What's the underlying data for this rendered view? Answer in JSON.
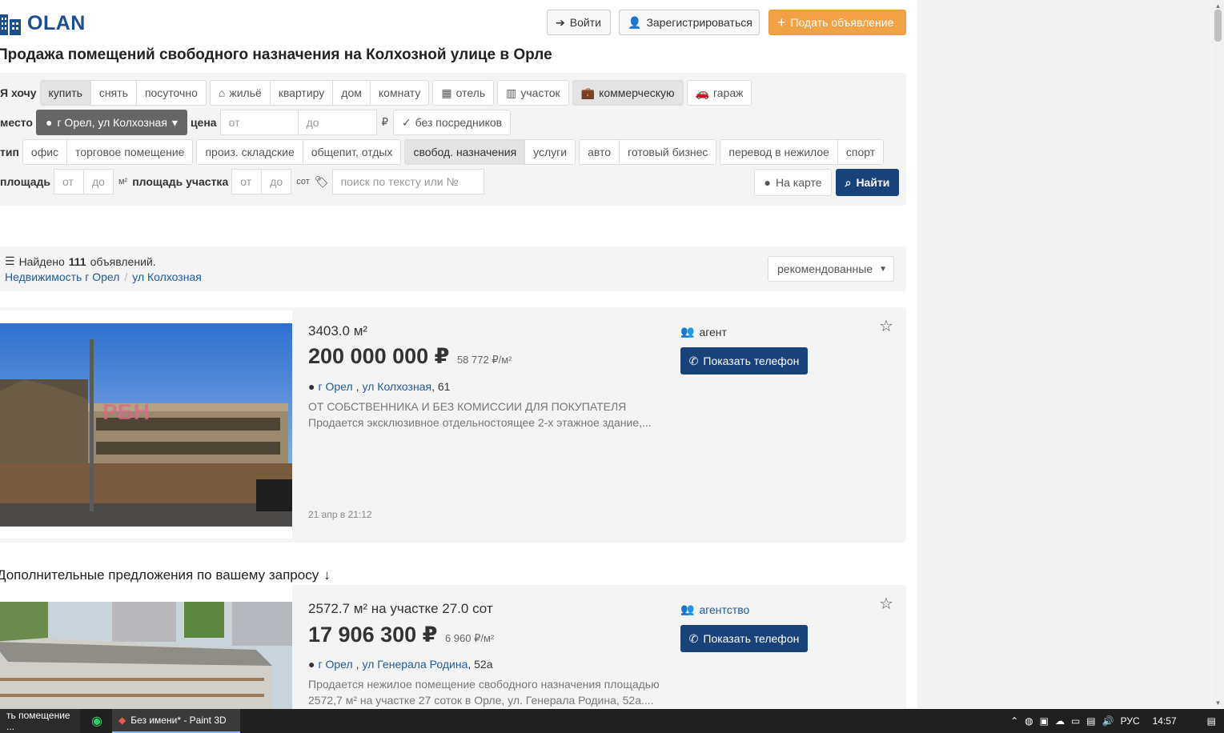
{
  "header": {
    "logo_text": "OLAN",
    "login_label": "Войти",
    "register_label": "Зарегистрироваться",
    "post_label": "Подать объявление"
  },
  "page_title": "Продажа помещений свободного назначения на Колхозной улице в Орле",
  "filter": {
    "want_label": "Я хочу",
    "deal_options": [
      "купить",
      "снять",
      "посуточно"
    ],
    "deal_selected": "купить",
    "property_options": [
      "жильё",
      "квартиру",
      "дом",
      "комнату",
      "отель",
      "участок",
      "коммерческую",
      "гараж"
    ],
    "property_selected": "коммерческую",
    "place_label": "место",
    "place_value": "г Орел, ул Колхозная",
    "price_label": "цена",
    "price_from_placeholder": "от",
    "price_to_placeholder": "до",
    "currency": "₽",
    "no_agents_label": "без посредников",
    "type_label": "тип",
    "type_options": [
      "офис",
      "торговое помещение",
      "произ. складские",
      "общепит, отдых",
      "свобод. назначения",
      "услуги",
      "авто",
      "готовый бизнес",
      "перевод в нежилое",
      "спорт"
    ],
    "type_selected": "свобод. назначения",
    "area_label": "площадь",
    "area_from_placeholder": "от",
    "area_to_placeholder": "до",
    "area_unit": "м²",
    "plot_label": "площадь участка",
    "plot_from_placeholder": "от",
    "plot_to_placeholder": "до",
    "plot_unit": "сот",
    "search_placeholder": "поиск по тексту или №",
    "map_label": "На карте",
    "find_label": "Найти"
  },
  "results": {
    "found_prefix": "Найдено",
    "found_count": "111",
    "found_suffix": "объявлений.",
    "crumb_1": "Недвижимость г Орел",
    "crumb_sep": "/",
    "crumb_2": "ул Колхозная",
    "sort_label": "рекомендованные"
  },
  "listings": [
    {
      "area": "3403.0 м²",
      "price": "200 000 000 ₽",
      "price_per_m2": "58 772 ₽/м²",
      "city_link": "г Орел",
      "street_link": "ул Колхозная",
      "house": ", 61",
      "desc_line1": "ОТ СОБСТВЕННИКА И БЕЗ КОМИССИИ ДЛЯ ПОКУПАТЕЛЯ",
      "desc_line2": "Продается эксклюзивное отдельностоящее 2-х этажное здание,...",
      "date": "21 апр в 21:12",
      "seller": "агент",
      "phone_label": "Показать телефон",
      "photo_watermark": "РБН"
    },
    {
      "area": "2572.7 м² на участке 27.0 сот",
      "price": "17 906 300 ₽",
      "price_per_m2": "6 960 ₽/м²",
      "city_link": "г Орел",
      "street_link": "ул Генерала Родина",
      "house": ", 52а",
      "desc_line1": "Продается нежилое помещение свободного назначения площадью",
      "desc_line2": "2572,7 м² на участке 27 соток в Орле, ул. Генерала Родина, 52а....",
      "seller": "агентство",
      "phone_label": "Показать телефон"
    }
  ],
  "extra_title": "Дополнительные предложения по вашему запросу",
  "taskbar": {
    "item_1": "ть помещение ...",
    "item_2": "Без имени* - Paint 3D",
    "lang": "РУС",
    "time": "14:57"
  }
}
